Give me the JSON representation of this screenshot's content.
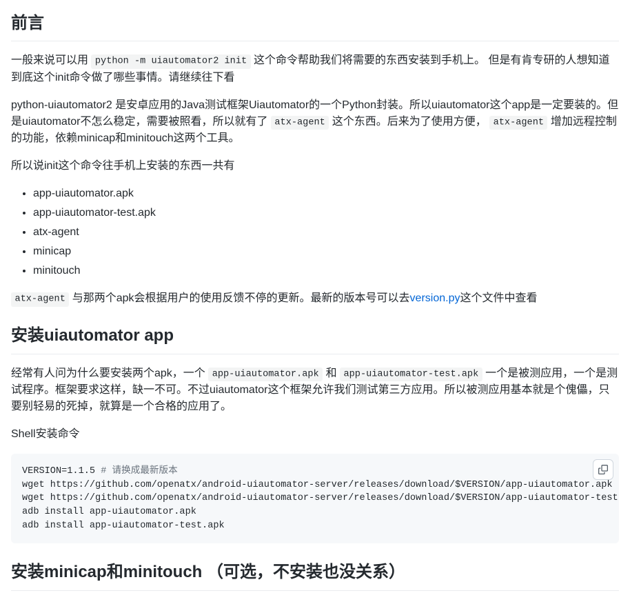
{
  "section1": {
    "heading": "前言",
    "p1a": "一般来说可以用 ",
    "p1_code": "python -m uiautomator2 init",
    "p1b": " 这个命令帮助我们将需要的东西安装到手机上。 但是有肯专研的人想知道到底这个init命令做了哪些事情。请继续往下看",
    "p2a": "python-uiautomator2 是安卓应用的Java测试框架Uiautomator的一个Python封装。所以uiautomator这个app是一定要装的。但是uiautomator不怎么稳定，需要被照看，所以就有了 ",
    "p2_code1": "atx-agent",
    "p2b": " 这个东西。后来为了使用方便， ",
    "p2_code2": "atx-agent",
    "p2c": " 增加远程控制的功能，依赖minicap和minitouch这两个工具。",
    "p3": "所以说init这个命令往手机上安装的东西一共有",
    "list": [
      "app-uiautomator.apk",
      "app-uiautomator-test.apk",
      "atx-agent",
      "minicap",
      "minitouch"
    ],
    "p4_code": "atx-agent",
    "p4a": " 与那两个apk会根据用户的使用反馈不停的更新。最新的版本号可以去",
    "p4_link": "version.py",
    "p4b": "这个文件中查看"
  },
  "section2": {
    "heading": "安装uiautomator app",
    "p1a": "经常有人问为什么要安装两个apk，一个 ",
    "p1_code1": "app-uiautomator.apk",
    "p1b": " 和 ",
    "p1_code2": "app-uiautomator-test.apk",
    "p1c": " 一个是被测应用，一个是测试程序。框架要求这样，缺一不可。不过uiautomator这个框架允许我们测试第三方应用。所以被测应用基本就是个傀儡，只要别轻易的死掉，就算是一个合格的应用了。",
    "p2": "Shell安装命令",
    "code": {
      "line1a": "VERSION=1.1.5 ",
      "line1b": "# 请换成最新版本",
      "line2": "wget https://github.com/openatx/android-uiautomator-server/releases/download/$VERSION/app-uiautomator.apk",
      "line3": "wget https://github.com/openatx/android-uiautomator-server/releases/download/$VERSION/app-uiautomator-test.apk",
      "line4": "adb install app-uiautomator.apk",
      "line5": "adb install app-uiautomator-test.apk"
    }
  },
  "section3": {
    "heading": "安装minicap和minitouch （可选，不安装也没关系）"
  }
}
